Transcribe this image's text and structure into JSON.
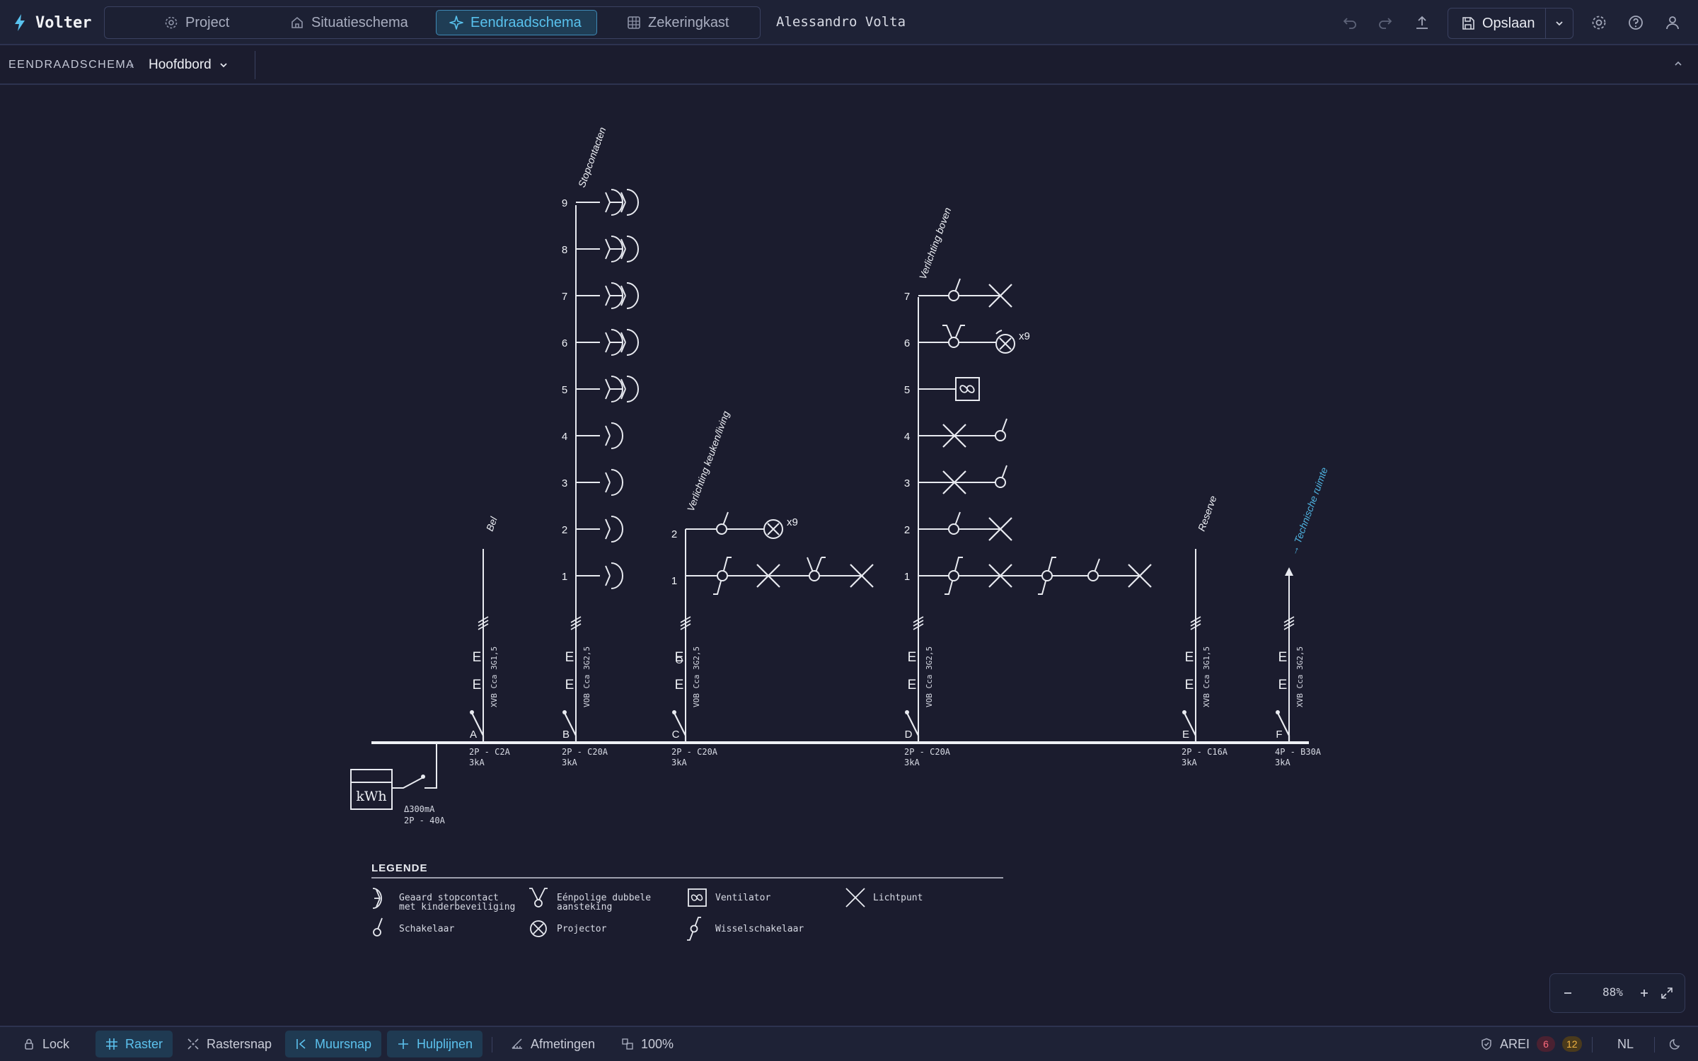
{
  "app": {
    "name": "Volter",
    "accent": "#59c2ee"
  },
  "tabs": [
    {
      "label": "Project",
      "icon": "gear-icon"
    },
    {
      "label": "Situatieschema",
      "icon": "house-icon"
    },
    {
      "label": "Eendraadschema",
      "icon": "sparkle-icon",
      "active": true
    },
    {
      "label": "Zekeringkast",
      "icon": "grid-icon"
    }
  ],
  "user": "Alessandro Volta",
  "toolbar": {
    "save_label": "Opslaan"
  },
  "breadcrumb": {
    "section": "EENDRAADSCHEMA",
    "separator": "›",
    "board": "Hoofdbord"
  },
  "diagram": {
    "main": {
      "kwh": "kWh",
      "diff": "Δ300mA",
      "rating": "2P - 40A"
    },
    "circuits": [
      {
        "letter": "A",
        "name": "Bel",
        "cable": "XVB Cca 3G1,5",
        "breaker": "2P - C2A",
        "ka": "3kA",
        "points": []
      },
      {
        "letter": "B",
        "name": "Stopcontacten",
        "cable": "VOB Cca 3G2,5",
        "breaker": "2P - C20A",
        "ka": "3kA",
        "points": [
          "1",
          "2",
          "3",
          "4",
          "5",
          "6",
          "7",
          "8",
          "9"
        ]
      },
      {
        "letter": "C",
        "name": "Verlichting keuken/living",
        "cable": "VOB Cca 3G2,5",
        "breaker": "2P - C20A",
        "ka": "3kA",
        "points": [
          "1",
          "2"
        ],
        "multiplier": "x9"
      },
      {
        "letter": "D",
        "name": "Verlichting boven",
        "cable": "VOB Cca 3G2,5",
        "breaker": "2P - C20A",
        "ka": "3kA",
        "points": [
          "1",
          "2",
          "3",
          "4",
          "5",
          "6",
          "7"
        ],
        "multiplier": "x9"
      },
      {
        "letter": "E",
        "name": "Reserve",
        "cable": "XVB Cca 3G1,5",
        "breaker": "2P - C16A",
        "ka": "3kA",
        "points": []
      },
      {
        "letter": "F",
        "name": "→ Technische ruimte",
        "cable": "XVB Cca 3G2,5",
        "breaker": "4P - B30A",
        "ka": "3kA",
        "points": []
      }
    ],
    "legend": {
      "title": "LEGENDE",
      "items": [
        {
          "label": "Geaard stopcontact met kinderbeveiliging",
          "line1": "Geaard stopcontact",
          "line2": "met kinderbeveiliging",
          "icon": "socket-icon"
        },
        {
          "label": "Eénpolige dubbele aansteking",
          "line1": "Eénpolige dubbele",
          "line2": "aansteking",
          "icon": "double-switch-icon"
        },
        {
          "label": "Ventilator",
          "icon": "fan-icon"
        },
        {
          "label": "Lichtpunt",
          "icon": "lightpoint-icon"
        },
        {
          "label": "Schakelaar",
          "icon": "switch-icon"
        },
        {
          "label": "Projector",
          "icon": "projector-icon"
        },
        {
          "label": "Wisselschakelaar",
          "icon": "two-way-switch-icon"
        }
      ]
    }
  },
  "zoom": {
    "value": "88%"
  },
  "bottombar": {
    "lock": "Lock",
    "raster": "Raster",
    "rastersnap": "Rastersnap",
    "muursnap": "Muursnap",
    "hulplijnen": "Hulplijnen",
    "afmetingen": "Afmetingen",
    "scale": "100%",
    "arei": "AREI",
    "errors": "6",
    "warnings": "12",
    "language": "NL"
  }
}
